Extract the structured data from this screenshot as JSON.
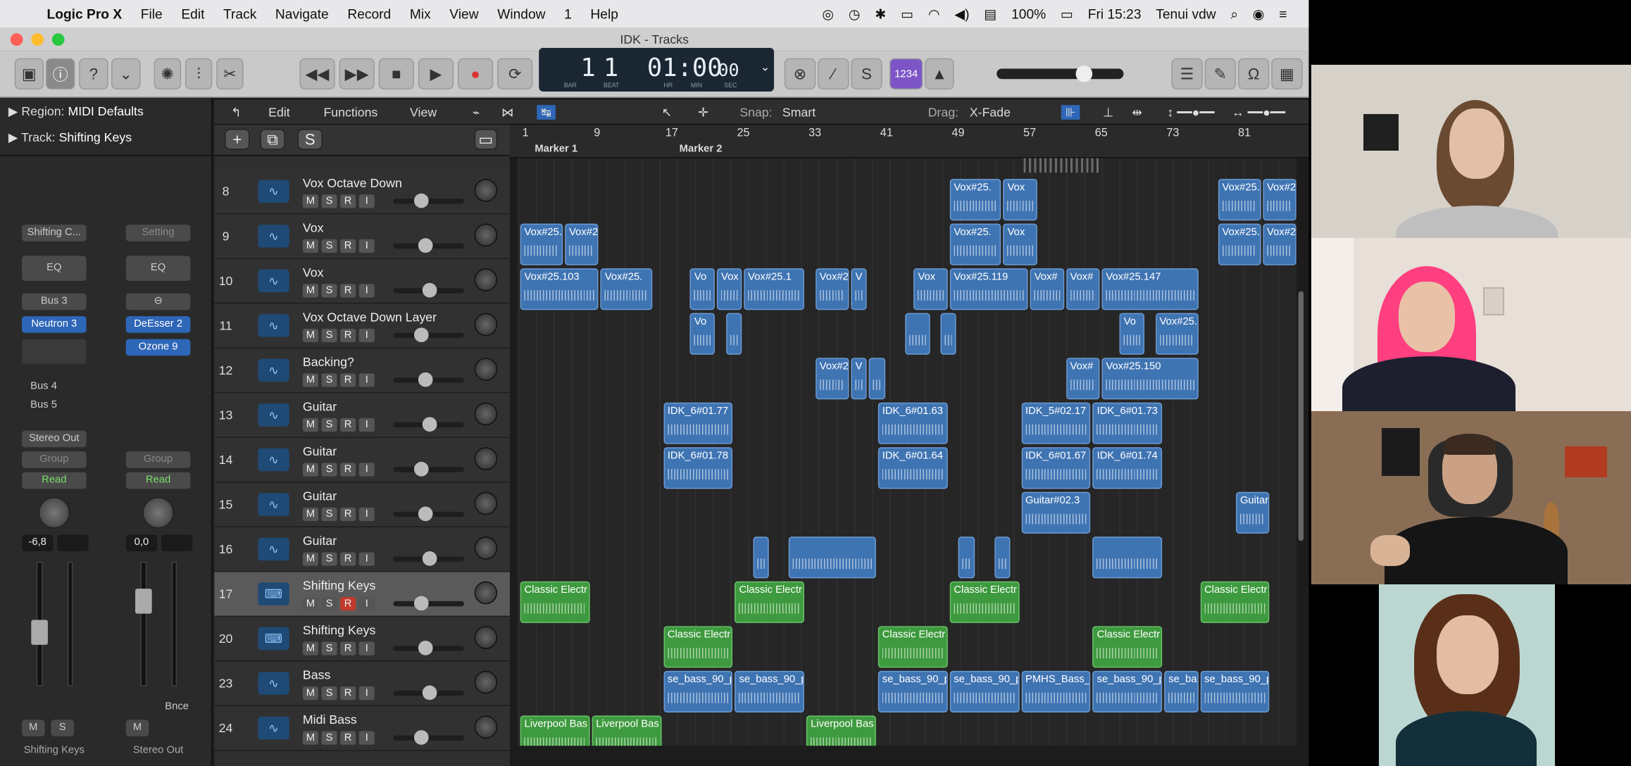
{
  "menubar": {
    "app": "Logic Pro X",
    "items": [
      "File",
      "Edit",
      "Track",
      "Navigate",
      "Record",
      "Mix",
      "View",
      "Window",
      "1",
      "Help"
    ],
    "battery": "100%",
    "clock": "Fri 15:23",
    "user": "Tenui vdw"
  },
  "window": {
    "title": "IDK - Tracks"
  },
  "lcd": {
    "bar": "1",
    "beat": "1",
    "time": "01:00",
    "sub": "00",
    "bar_label": "BAR",
    "beat_label": "BEAT",
    "hr_label": "HR",
    "min_label": "MIN",
    "sec_label": "SEC"
  },
  "toolbar": {
    "count_in": "1234"
  },
  "inspector": {
    "region_label": "Region:",
    "region_value": "MIDI Defaults",
    "track_label": "Track:",
    "track_value": "Shifting Keys",
    "strip1": {
      "setting": "Shifting C...",
      "eq": "EQ",
      "send1": "Bus 3",
      "plugin1": "Neutron 3",
      "bus4": "Bus 4",
      "bus5": "Bus 5",
      "output": "Stereo Out",
      "group": "Group",
      "automation": "Read",
      "volume": "-6,8",
      "mute": "M",
      "solo": "S",
      "name": "Shifting Keys"
    },
    "strip2": {
      "setting": "Setting",
      "eq": "EQ",
      "plugin1": "DeEsser 2",
      "plugin2": "Ozone 9",
      "group": "Group",
      "automation": "Read",
      "volume": "0,0",
      "mute": "M",
      "bounce": "Bnce",
      "name": "Stereo Out"
    }
  },
  "tracks_toolbar": {
    "edit": "Edit",
    "functions": "Functions",
    "view": "View",
    "snap_label": "Snap:",
    "snap_value": "Smart",
    "drag_label": "Drag:",
    "drag_value": "X-Fade"
  },
  "header_top": {
    "add": "+",
    "solo": "S"
  },
  "ruler": {
    "bars": [
      "1",
      "9",
      "17",
      "25",
      "33",
      "41",
      "49",
      "57",
      "65",
      "73",
      "81"
    ],
    "markers": [
      "Marker 1",
      "Marker 2"
    ]
  },
  "tracks": [
    {
      "num": "8",
      "name": "Vox Octave Down",
      "rec": false
    },
    {
      "num": "9",
      "name": "Vox",
      "rec": false
    },
    {
      "num": "10",
      "name": "Vox",
      "rec": false
    },
    {
      "num": "11",
      "name": "Vox Octave Down Layer",
      "rec": false
    },
    {
      "num": "12",
      "name": "Backing?",
      "rec": false
    },
    {
      "num": "13",
      "name": "Guitar",
      "rec": false
    },
    {
      "num": "14",
      "name": "Guitar",
      "rec": false
    },
    {
      "num": "15",
      "name": "Guitar",
      "rec": false
    },
    {
      "num": "16",
      "name": "Guitar",
      "rec": false
    },
    {
      "num": "17",
      "name": "Shifting Keys",
      "rec": true
    },
    {
      "num": "20",
      "name": "Shifting Keys",
      "rec": false
    },
    {
      "num": "23",
      "name": "Bass",
      "rec": false
    },
    {
      "num": "24",
      "name": "Midi Bass",
      "rec": false
    }
  ],
  "track_buttons": {
    "m": "M",
    "s": "S",
    "r": "R",
    "i": "I"
  },
  "regions": [
    {
      "row": 0,
      "start": 49,
      "len": 6,
      "name": "Vox#25.",
      "color": "blue"
    },
    {
      "row": 0,
      "start": 55,
      "len": 4,
      "name": "Vox",
      "color": "blue"
    },
    {
      "row": 0,
      "start": 79,
      "len": 5,
      "name": "Vox#25.",
      "color": "blue"
    },
    {
      "row": 0,
      "start": 84,
      "len": 4,
      "name": "Vox#2",
      "color": "blue"
    },
    {
      "row": 1,
      "start": 1,
      "len": 5,
      "name": "Vox#25.",
      "color": "blue"
    },
    {
      "row": 1,
      "start": 6,
      "len": 4,
      "name": "Vox#2",
      "color": "blue"
    },
    {
      "row": 1,
      "start": 49,
      "len": 6,
      "name": "Vox#25.",
      "color": "blue"
    },
    {
      "row": 1,
      "start": 55,
      "len": 4,
      "name": "Vox",
      "color": "blue"
    },
    {
      "row": 1,
      "start": 79,
      "len": 5,
      "name": "Vox#25.",
      "color": "blue"
    },
    {
      "row": 1,
      "start": 84,
      "len": 4,
      "name": "Vox#2",
      "color": "blue"
    },
    {
      "row": 2,
      "start": 1,
      "len": 9,
      "name": "Vox#25.103",
      "color": "blue"
    },
    {
      "row": 2,
      "start": 10,
      "len": 6,
      "name": "Vox#25.",
      "color": "blue"
    },
    {
      "row": 2,
      "start": 20,
      "len": 3,
      "name": "Vo",
      "color": "blue"
    },
    {
      "row": 2,
      "start": 23,
      "len": 3,
      "name": "Vox",
      "color": "blue"
    },
    {
      "row": 2,
      "start": 26,
      "len": 7,
      "name": "Vox#25.1",
      "color": "blue"
    },
    {
      "row": 2,
      "start": 34,
      "len": 4,
      "name": "Vox#2",
      "color": "blue"
    },
    {
      "row": 2,
      "start": 38,
      "len": 2,
      "name": "V",
      "color": "blue"
    },
    {
      "row": 2,
      "start": 45,
      "len": 4,
      "name": "Vox",
      "color": "blue"
    },
    {
      "row": 2,
      "start": 49,
      "len": 9,
      "name": "Vox#25.119",
      "color": "blue"
    },
    {
      "row": 2,
      "start": 58,
      "len": 4,
      "name": "Vox#",
      "color": "blue"
    },
    {
      "row": 2,
      "start": 62,
      "len": 4,
      "name": "Vox#",
      "color": "blue"
    },
    {
      "row": 2,
      "start": 66,
      "len": 11,
      "name": "Vox#25.147",
      "color": "blue"
    },
    {
      "row": 3,
      "start": 20,
      "len": 3,
      "name": "Vo",
      "color": "blue"
    },
    {
      "row": 3,
      "start": 24,
      "len": 2,
      "name": "",
      "color": "blue"
    },
    {
      "row": 3,
      "start": 44,
      "len": 3,
      "name": "",
      "color": "blue"
    },
    {
      "row": 3,
      "start": 48,
      "len": 2,
      "name": "",
      "color": "blue"
    },
    {
      "row": 3,
      "start": 68,
      "len": 3,
      "name": "Vo",
      "color": "blue"
    },
    {
      "row": 3,
      "start": 72,
      "len": 5,
      "name": "Vox#25.",
      "color": "blue"
    },
    {
      "row": 4,
      "start": 34,
      "len": 4,
      "name": "Vox#2",
      "color": "blue"
    },
    {
      "row": 4,
      "start": 38,
      "len": 2,
      "name": "V",
      "color": "blue"
    },
    {
      "row": 4,
      "start": 40,
      "len": 2,
      "name": "",
      "color": "blue"
    },
    {
      "row": 4,
      "start": 62,
      "len": 4,
      "name": "Vox#",
      "color": "blue"
    },
    {
      "row": 4,
      "start": 66,
      "len": 11,
      "name": "Vox#25.150",
      "color": "blue"
    },
    {
      "row": 5,
      "start": 17,
      "len": 8,
      "name": "IDK_6#01.77",
      "color": "blue"
    },
    {
      "row": 5,
      "start": 41,
      "len": 8,
      "name": "IDK_6#01.63",
      "color": "blue"
    },
    {
      "row": 5,
      "start": 57,
      "len": 8,
      "name": "IDK_5#02.17",
      "color": "blue"
    },
    {
      "row": 5,
      "start": 65,
      "len": 8,
      "name": "IDK_6#01.73",
      "color": "blue"
    },
    {
      "row": 6,
      "start": 17,
      "len": 8,
      "name": "IDK_6#01.78",
      "color": "blue"
    },
    {
      "row": 6,
      "start": 41,
      "len": 8,
      "name": "IDK_6#01.64",
      "color": "blue"
    },
    {
      "row": 6,
      "start": 57,
      "len": 8,
      "name": "IDK_6#01.67",
      "color": "blue"
    },
    {
      "row": 6,
      "start": 65,
      "len": 8,
      "name": "IDK_6#01.74",
      "color": "blue"
    },
    {
      "row": 7,
      "start": 57,
      "len": 8,
      "name": "Guitar#02.3",
      "color": "blue"
    },
    {
      "row": 7,
      "start": 81,
      "len": 4,
      "name": "Guitar",
      "color": "blue"
    },
    {
      "row": 8,
      "start": 27,
      "len": 2,
      "name": "",
      "color": "blue"
    },
    {
      "row": 8,
      "start": 31,
      "len": 10,
      "name": "",
      "color": "blue"
    },
    {
      "row": 8,
      "start": 50,
      "len": 2,
      "name": "",
      "color": "blue"
    },
    {
      "row": 8,
      "start": 54,
      "len": 2,
      "name": "",
      "color": "blue"
    },
    {
      "row": 8,
      "start": 65,
      "len": 8,
      "name": "",
      "color": "blue"
    },
    {
      "row": 9,
      "start": 1,
      "len": 8,
      "name": "Classic Electr",
      "color": "green"
    },
    {
      "row": 9,
      "start": 25,
      "len": 8,
      "name": "Classic Electr",
      "color": "green"
    },
    {
      "row": 9,
      "start": 49,
      "len": 8,
      "name": "Classic Electr",
      "color": "green"
    },
    {
      "row": 9,
      "start": 77,
      "len": 8,
      "name": "Classic Electr",
      "color": "green"
    },
    {
      "row": 10,
      "start": 17,
      "len": 8,
      "name": "Classic Electr",
      "color": "green"
    },
    {
      "row": 10,
      "start": 41,
      "len": 8,
      "name": "Classic Electr",
      "color": "green"
    },
    {
      "row": 10,
      "start": 65,
      "len": 8,
      "name": "Classic Electr",
      "color": "green"
    },
    {
      "row": 11,
      "start": 17,
      "len": 8,
      "name": "se_bass_90_p",
      "color": "blue"
    },
    {
      "row": 11,
      "start": 25,
      "len": 8,
      "name": "se_bass_90_p",
      "color": "blue"
    },
    {
      "row": 11,
      "start": 41,
      "len": 8,
      "name": "se_bass_90_p",
      "color": "blue"
    },
    {
      "row": 11,
      "start": 49,
      "len": 8,
      "name": "se_bass_90_p",
      "color": "blue"
    },
    {
      "row": 11,
      "start": 57,
      "len": 8,
      "name": "PMHS_Bass_L",
      "color": "blue"
    },
    {
      "row": 11,
      "start": 65,
      "len": 8,
      "name": "se_bass_90_p",
      "color": "blue"
    },
    {
      "row": 11,
      "start": 73,
      "len": 4,
      "name": "se_ba",
      "color": "blue"
    },
    {
      "row": 11,
      "start": 77,
      "len": 8,
      "name": "se_bass_90_p",
      "color": "blue"
    },
    {
      "row": 12,
      "start": 1,
      "len": 8,
      "name": "Liverpool Bas",
      "color": "green"
    },
    {
      "row": 12,
      "start": 9,
      "len": 8,
      "name": "Liverpool Bas",
      "color": "green"
    },
    {
      "row": 12,
      "start": 33,
      "len": 8,
      "name": "Liverpool Bas",
      "color": "green"
    }
  ],
  "colors": {
    "blue_region": "#3f74b3",
    "green_region": "#3e9a3e",
    "record": "#c0392b",
    "accent": "#2e66b8"
  },
  "video_participants": [
    {
      "id": "participant-1",
      "hair": "#6b4a32",
      "bg": "#d9d3c8",
      "shirt": "#bfbfbf"
    },
    {
      "id": "participant-2",
      "hair": "#ff3f7f",
      "bg": "#eae2dc",
      "shirt": "#1d1f2e"
    },
    {
      "id": "participant-3",
      "hair": "#3a2a1f",
      "bg": "#8a6d55",
      "shirt": "#151515"
    },
    {
      "id": "participant-4",
      "hair": "#5a2f1a",
      "bg": "#bcd7d2",
      "shirt": "#13303a"
    }
  ]
}
